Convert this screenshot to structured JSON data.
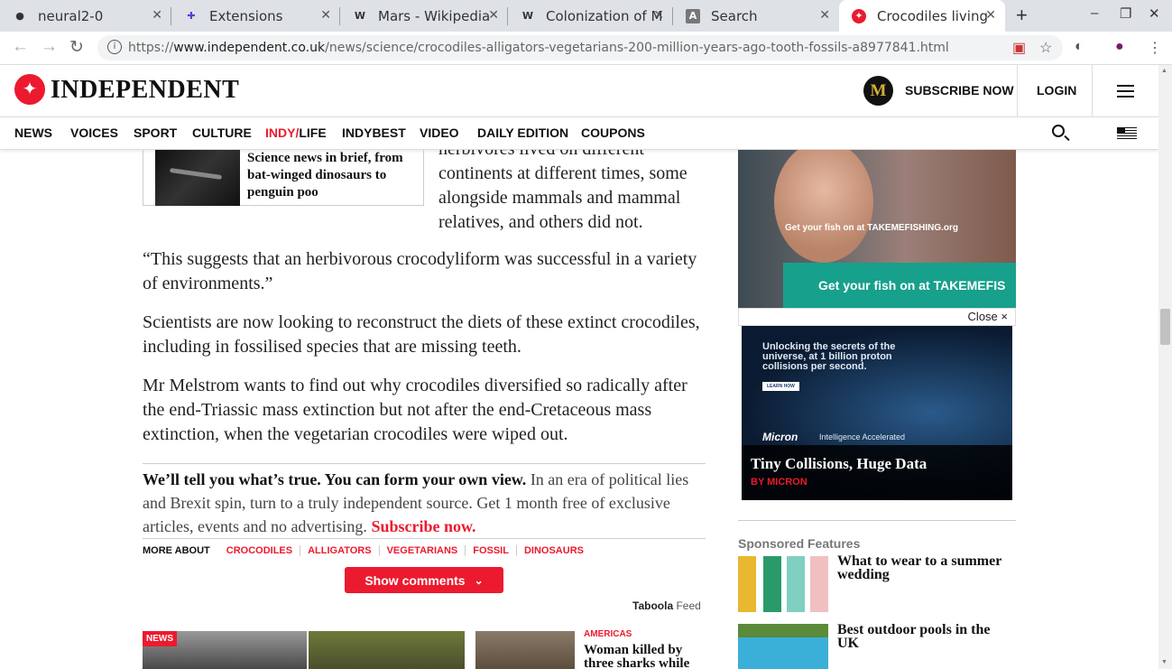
{
  "browser": {
    "tabs": [
      {
        "label": "neural2-0",
        "icon": "github-icon"
      },
      {
        "label": "Extensions",
        "icon": "puzzle-icon"
      },
      {
        "label": "Mars - Wikipedia",
        "icon": "wikipedia-icon"
      },
      {
        "label": "Colonization of M",
        "icon": "wikipedia-icon"
      },
      {
        "label": "Search",
        "icon": "search-tab-icon"
      },
      {
        "label": "Crocodiles living",
        "icon": "independent-icon"
      }
    ],
    "url_scheme": "https://",
    "url_host": "www.independent.co.uk",
    "url_path": "/news/science/crocodiles-alligators-vegetarians-200-million-years-ago-tooth-fossils-a8977841.html"
  },
  "header": {
    "logo_text": "INDEPENDENT",
    "m_badge": "M",
    "subscribe": "SUBSCRIBE NOW",
    "login": "LOGIN"
  },
  "nav": {
    "items": [
      "NEWS",
      "VOICES",
      "SPORT",
      "CULTURE"
    ],
    "indy_part1": "INDY/",
    "indy_part2": "LIFE",
    "items2": [
      "INDYBEST",
      "VIDEO",
      "DAILY EDITION",
      "COUPONS"
    ]
  },
  "article": {
    "related_title": "Science news in brief, from bat-winged dinosaurs to penguin poo",
    "side_text": "herbivores lived on different continents at different times, some alongside mammals and mammal relatives, and others did not.",
    "para1": "“This suggests that an herbivorous crocodyliform was successful in a variety of environments.”",
    "para2": "Scientists are now looking to reconstruct the diets of these extinct crocodiles, including in fossilised species that are missing teeth.",
    "para3": "Mr Melstrom wants to find out why crocodiles diversified so radically after the end-Triassic mass extinction but not after the end-Cretaceous mass extinction, when the vegetarian crocodiles were wiped out.",
    "promo_bold": "We’ll tell you what’s true. You can form your own view.",
    "promo_text": " In an era of political lies and Brexit spin, turn to a truly independent source. Get 1 month free of exclusive articles, events and no advertising. ",
    "promo_link": "Subscribe now.",
    "more_about": "MORE ABOUT",
    "tags": [
      "CROCODILES",
      "ALLIGATORS",
      "VEGETARIANS",
      "FOSSIL",
      "DINOSAURS"
    ],
    "show_comments": "Show comments",
    "taboola": "Taboola",
    "taboola_feed": "Feed",
    "news_tag": "NEWS",
    "card_section": "AMERICAS",
    "card_title": "Woman killed by three sharks while"
  },
  "sidebar": {
    "ad1_small": "Get your fish on at  TAKEMEFISHING.org",
    "ad1_bar": "Get your fish on at  TAKEMEFIS",
    "close": "Close ×",
    "ad2_headline": "Unlocking the secrets of the universe, at 1 billion proton collisions per second.",
    "ad2_learn": "LEARN HOW",
    "ad2_brand": "Micron",
    "ad2_tagline": "Intelligence Accelerated",
    "ad2_title": "Tiny Collisions, Huge Data",
    "ad2_by": "BY MICRON",
    "sponsored_label": "Sponsored Features",
    "sponsored": [
      {
        "title": "What to wear to a summer wedding"
      },
      {
        "title": "Best outdoor pools in the UK"
      }
    ]
  },
  "colors": {
    "accent": "#ec1a2e",
    "teal": "#17a08c"
  }
}
